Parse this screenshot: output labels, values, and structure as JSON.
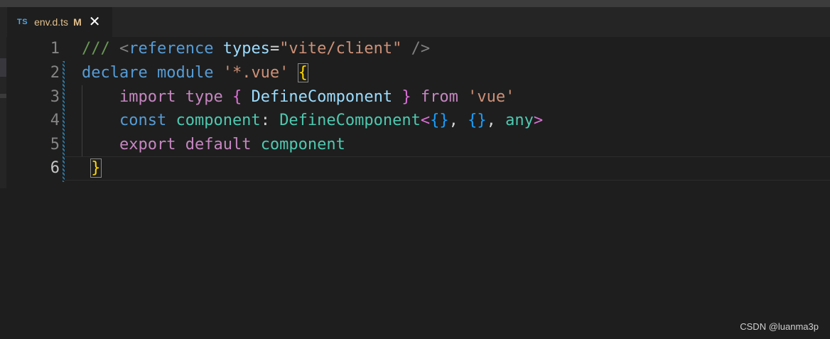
{
  "tab": {
    "lang_badge": "TS",
    "filename": "env.d.ts",
    "status": "M",
    "close": "✕"
  },
  "editor": {
    "line_numbers": [
      "1",
      "2",
      "3",
      "4",
      "5",
      "6"
    ],
    "lines": [
      [
        {
          "t": "/// ",
          "c": "c-comment"
        },
        {
          "t": "<",
          "c": "c-tag"
        },
        {
          "t": "reference",
          "c": "c-kw"
        },
        {
          "t": " ",
          "c": "c-plain"
        },
        {
          "t": "types",
          "c": "c-attr"
        },
        {
          "t": "=",
          "c": "c-plain"
        },
        {
          "t": "\"vite/client\"",
          "c": "c-str"
        },
        {
          "t": " />",
          "c": "c-tag"
        }
      ],
      [
        {
          "t": "declare",
          "c": "c-kw"
        },
        {
          "t": " ",
          "c": "c-plain"
        },
        {
          "t": "module",
          "c": "c-kw"
        },
        {
          "t": " ",
          "c": "c-plain"
        },
        {
          "t": "'*.vue'",
          "c": "c-str"
        },
        {
          "t": " ",
          "c": "c-plain"
        },
        {
          "t": "{",
          "c": "c-b1 bm"
        }
      ],
      [
        {
          "t": "    ",
          "c": "c-plain"
        },
        {
          "t": "import",
          "c": "c-ctrl"
        },
        {
          "t": " ",
          "c": "c-plain"
        },
        {
          "t": "type",
          "c": "c-ctrl"
        },
        {
          "t": " ",
          "c": "c-plain"
        },
        {
          "t": "{",
          "c": "c-b2"
        },
        {
          "t": " DefineComponent ",
          "c": "c-var"
        },
        {
          "t": "}",
          "c": "c-b2"
        },
        {
          "t": " ",
          "c": "c-plain"
        },
        {
          "t": "from",
          "c": "c-ctrl"
        },
        {
          "t": " ",
          "c": "c-plain"
        },
        {
          "t": "'vue'",
          "c": "c-str"
        }
      ],
      [
        {
          "t": "    ",
          "c": "c-plain"
        },
        {
          "t": "const",
          "c": "c-kw"
        },
        {
          "t": " ",
          "c": "c-plain"
        },
        {
          "t": "component",
          "c": "c-type"
        },
        {
          "t": ": ",
          "c": "c-plain"
        },
        {
          "t": "DefineComponent",
          "c": "c-type"
        },
        {
          "t": "<",
          "c": "c-b2"
        },
        {
          "t": "{}",
          "c": "c-b3"
        },
        {
          "t": ", ",
          "c": "c-plain"
        },
        {
          "t": "{}",
          "c": "c-b3"
        },
        {
          "t": ", ",
          "c": "c-plain"
        },
        {
          "t": "any",
          "c": "c-type"
        },
        {
          "t": ">",
          "c": "c-b2"
        }
      ],
      [
        {
          "t": "    ",
          "c": "c-plain"
        },
        {
          "t": "export",
          "c": "c-ctrl"
        },
        {
          "t": " ",
          "c": "c-plain"
        },
        {
          "t": "default",
          "c": "c-ctrl"
        },
        {
          "t": " ",
          "c": "c-plain"
        },
        {
          "t": "component",
          "c": "c-type"
        }
      ],
      [
        {
          "t": " ",
          "c": "c-plain"
        },
        {
          "t": "}",
          "c": "c-b1 bm"
        }
      ]
    ]
  },
  "watermark": "CSDN @luanma3p"
}
